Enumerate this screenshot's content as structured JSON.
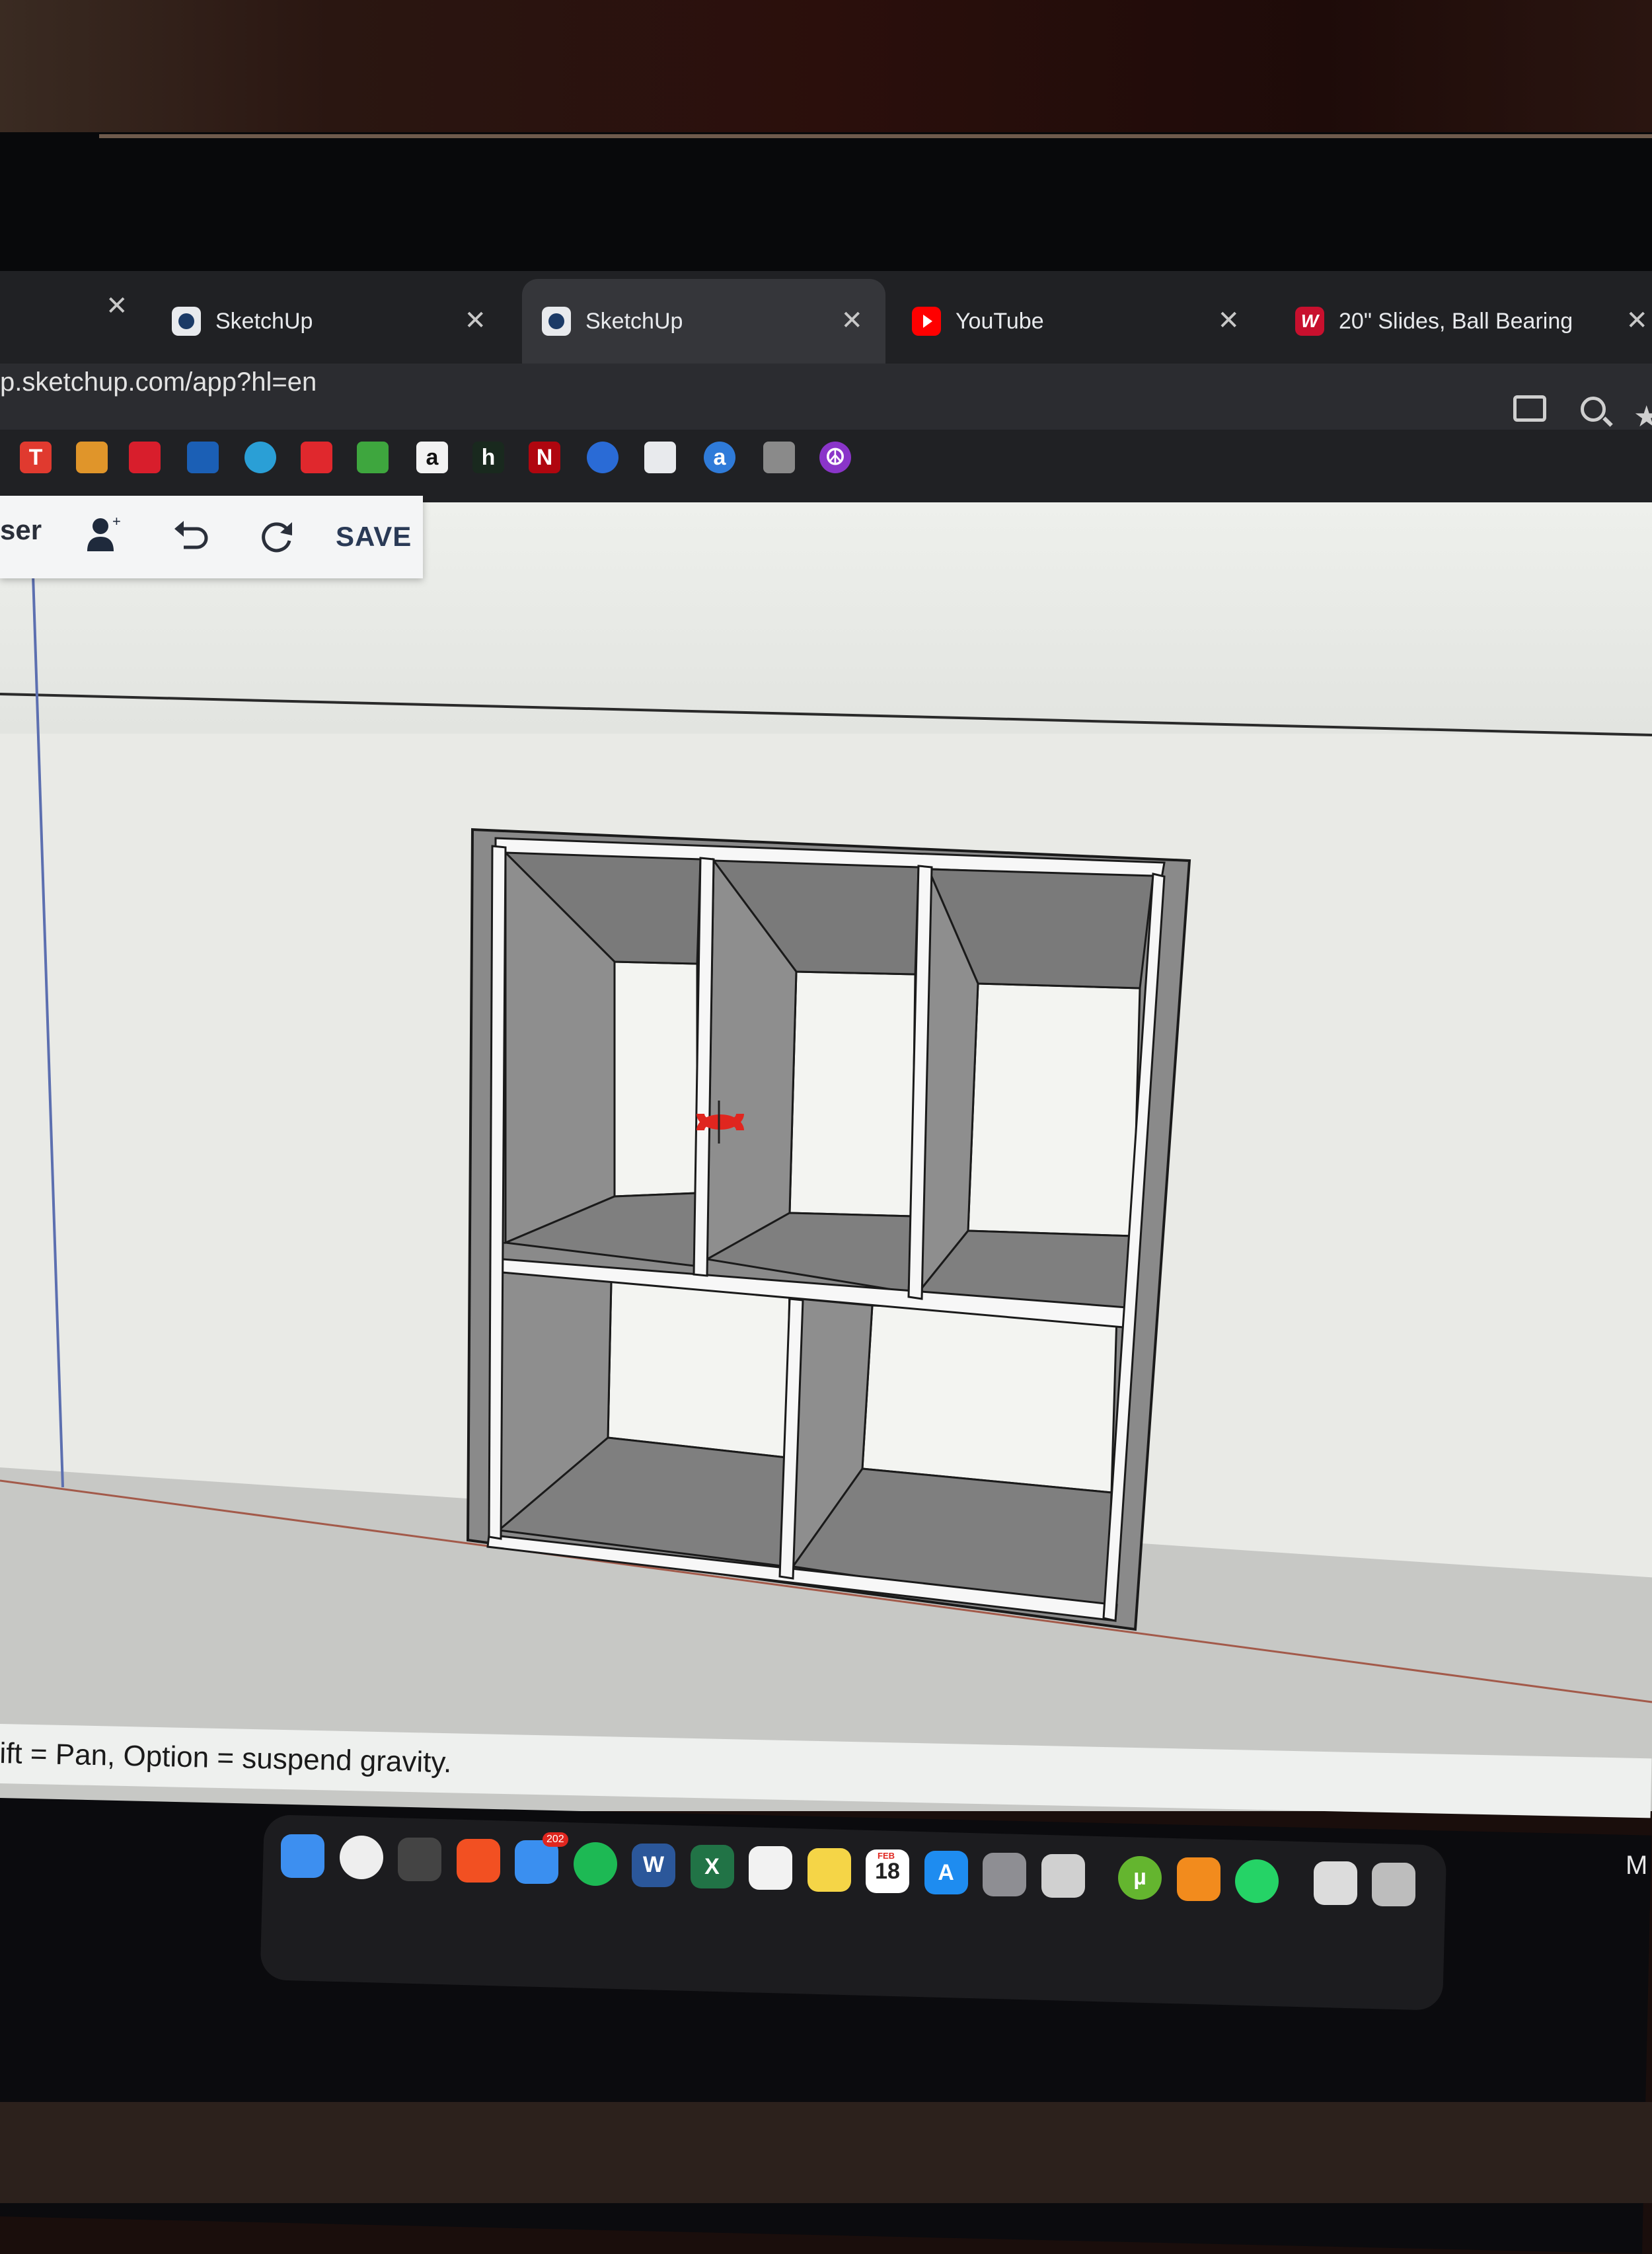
{
  "tabs": [
    {
      "title": "SketchUp",
      "icon": "sketchup-icon",
      "active": false
    },
    {
      "title": "SketchUp",
      "icon": "sketchup-icon",
      "active": true
    },
    {
      "title": "YouTube",
      "icon": "youtube-icon",
      "active": false
    },
    {
      "title": "20\" Slides, Ball Bearing",
      "icon": "woodworkers-express-icon",
      "active": false
    }
  ],
  "address": {
    "url": "p.sketchup.com/app?hl=en"
  },
  "bookmarks": [
    {
      "icon": "t-icon",
      "text": "T",
      "color": "#e03a2f"
    },
    {
      "icon": "gauge-icon",
      "text": "",
      "color": "#e0952a"
    },
    {
      "icon": "swoosh-icon",
      "text": "",
      "color": "#d81e2c"
    },
    {
      "icon": "chase-icon",
      "text": "",
      "color": "#1b5fb5"
    },
    {
      "icon": "att-icon",
      "text": "",
      "color": "#2a9fd6"
    },
    {
      "icon": "flag-icon",
      "text": "",
      "color": "#e0282d"
    },
    {
      "icon": "loader-icon",
      "text": "",
      "color": "#3ea63e"
    },
    {
      "icon": "amazon-icon",
      "text": "a",
      "color": "#f2f2f2"
    },
    {
      "icon": "h-icon",
      "text": "h",
      "color": "#19291e"
    },
    {
      "icon": "netflix-icon",
      "text": "N",
      "color": "#b0060f"
    },
    {
      "icon": "chat-icon",
      "text": "",
      "color": "#2a6bd6"
    },
    {
      "icon": "sketchup-icon",
      "text": "",
      "color": "#e8eaed"
    },
    {
      "icon": "a-icon",
      "text": "a",
      "color": "#2f7bd9"
    },
    {
      "icon": "diamond-icon",
      "text": "",
      "color": "#8a8a8a"
    },
    {
      "icon": "peace-icon",
      "text": "☮",
      "color": "#8a35c9"
    }
  ],
  "toolbar": {
    "user_label": "ser",
    "save_label": "SAVE"
  },
  "status": {
    "text": "ift = Pan, Option = suspend gravity."
  },
  "dock": {
    "apps": [
      {
        "name": "finder",
        "color": "#3d8ff0",
        "text": ""
      },
      {
        "name": "chrome",
        "color": "#eeeeee",
        "text": ""
      },
      {
        "name": "keychain",
        "color": "#444444",
        "text": ""
      },
      {
        "name": "brave",
        "color": "#f25022",
        "text": ""
      },
      {
        "name": "mail",
        "color": "#3a8ff0",
        "text": ""
      },
      {
        "name": "spotify",
        "color": "#1db954",
        "text": ""
      },
      {
        "name": "word",
        "color": "#2b579a",
        "text": "W"
      },
      {
        "name": "excel",
        "color": "#217346",
        "text": "X"
      },
      {
        "name": "photos",
        "color": "#f2f2f2",
        "text": ""
      },
      {
        "name": "notes",
        "color": "#f5d547",
        "text": ""
      },
      {
        "name": "calendar",
        "color": "#ffffff",
        "text": "18"
      },
      {
        "name": "app-store",
        "color": "#1e8cf0",
        "text": "A"
      },
      {
        "name": "system-settings",
        "color": "#8e8e93",
        "text": ""
      },
      {
        "name": "calculator",
        "color": "#d0d0d0",
        "text": ""
      },
      {
        "name": "utorrent",
        "color": "#64b52f",
        "text": "µ"
      },
      {
        "name": "vlc",
        "color": "#f28b1d",
        "text": ""
      },
      {
        "name": "whatsapp",
        "color": "#25d366",
        "text": ""
      },
      {
        "name": "files",
        "color": "#dcdcdc",
        "text": ""
      },
      {
        "name": "trash",
        "color": "#bdbdbd",
        "text": ""
      }
    ],
    "mail_badge": "202",
    "calendar_month": "FEB",
    "right_label": "M"
  },
  "colors": {
    "accent": "#1b3a66",
    "tab_bg": "#202124",
    "active_tab": "#35363a"
  }
}
